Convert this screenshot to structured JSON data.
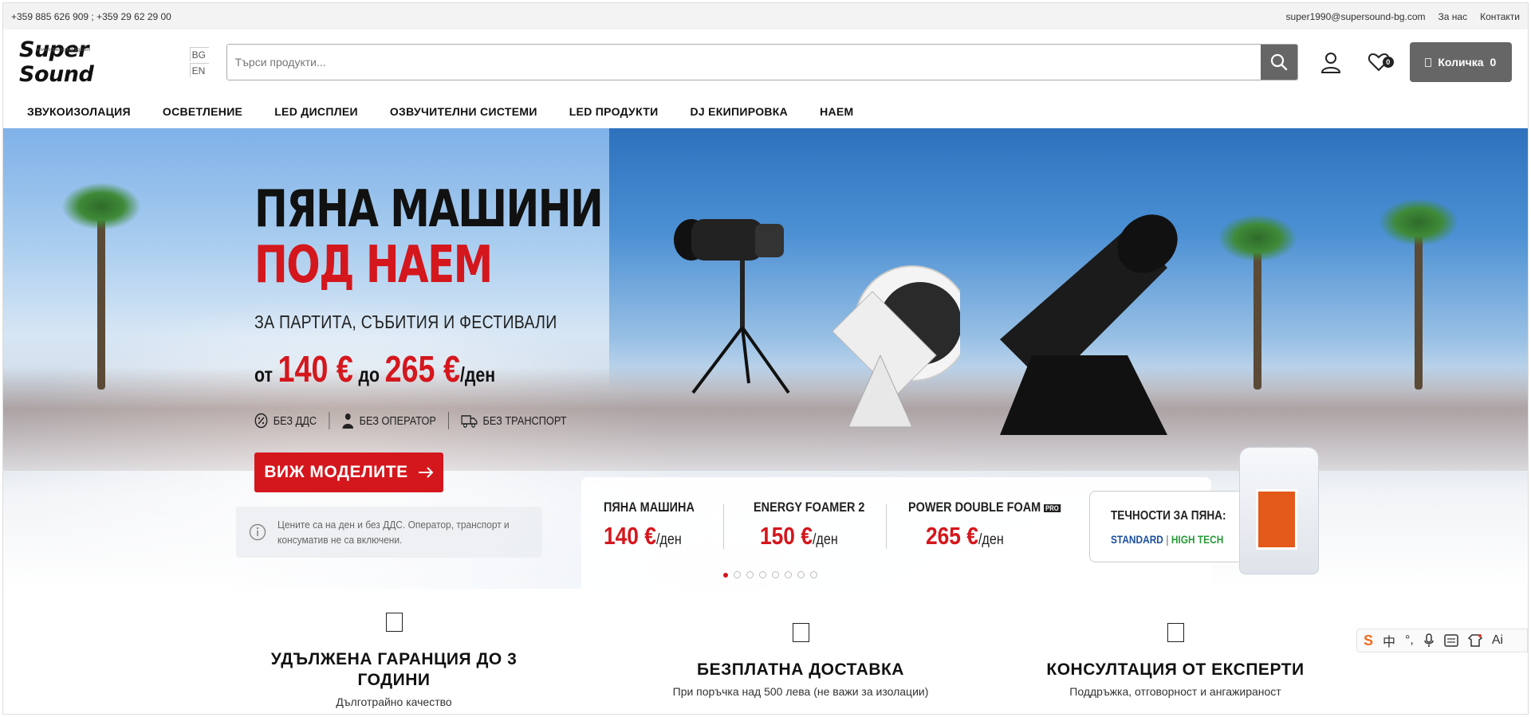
{
  "topbar": {
    "phones": "+359 885 626 909 ; +359 29 62 29 00",
    "email": "super1990@supersound-bg.com",
    "about": "За нас",
    "contacts": "Контакти"
  },
  "header": {
    "logo_text": "Super Sound",
    "logo_small": "www.supersound-bg.com",
    "lang_bg": "BG",
    "lang_en": "EN",
    "search_placeholder": "Търси продукти...",
    "wishlist_count": "0",
    "cart_label": "Количка",
    "cart_count": "0"
  },
  "nav": {
    "items": [
      "ЗВУКОИЗОЛАЦИЯ",
      "ОСВЕТЛЕНИЕ",
      "LED ДИСПЛЕИ",
      "ОЗВУЧИТЕЛНИ СИСТЕМИ",
      "LED ПРОДУКТИ",
      "DJ ЕКИПИРОВКА",
      "НАЕМ"
    ]
  },
  "hero": {
    "title_line1": "ПЯНА МАШИНИ",
    "title_line2": "ПОД НАЕМ",
    "subtitle": "ЗА ПАРТИТА, СЪБИТИЯ И ФЕСТИВАЛИ",
    "price_from_word": "от",
    "price_from": "140 €",
    "price_to_word": "до",
    "price_to": "265 €",
    "price_unit": "/ден",
    "features": [
      "БЕЗ ДДС",
      "БЕЗ ОПЕРАТОР",
      "БЕЗ ТРАНСПОРТ"
    ],
    "cta": "ВИЖ МОДЕЛИТЕ",
    "note": "Цените са на ден и без ДДС. Оператор, транспорт и консуматив не са включени.",
    "products": [
      {
        "name": "ПЯНА МАШИНА",
        "price": "140 €",
        "unit": "/ден"
      },
      {
        "name": "ENERGY FOAMER 2",
        "price": "150 €",
        "unit": "/ден"
      },
      {
        "name": "POWER DOUBLE FOAM",
        "badge": "PRO",
        "price": "265 €",
        "unit": "/ден"
      }
    ],
    "fluids_title": "ТЕЧНОСТИ ЗА ПЯНА:",
    "fluid_standard": "STANDARD",
    "fluid_hightech": "HIGH TECH",
    "slides_total": 8,
    "slide_active": 1
  },
  "benefits": [
    {
      "title": "УДЪЛЖЕНА ГАРАНЦИЯ ДО 3 ГОДИНИ",
      "subtitle": "Дълготрайно качество"
    },
    {
      "title": "БЕЗПЛАТНА ДОСТАВКА",
      "subtitle": "При поръчка над 500 лева (не важи за изолации)"
    },
    {
      "title": "КОНСУЛТАЦИЯ ОТ ЕКСПЕРТИ",
      "subtitle": "Поддръжка, отговорност и ангажираност"
    }
  ],
  "ime_toolbar": {
    "items": [
      "S",
      "中",
      "°,",
      "mic-icon",
      "keyboard-icon",
      "shirt-icon",
      "Ai"
    ]
  },
  "colors": {
    "accent_red": "#d4171d",
    "button_gray": "#666666",
    "topbar_bg": "#f3f3f3"
  }
}
